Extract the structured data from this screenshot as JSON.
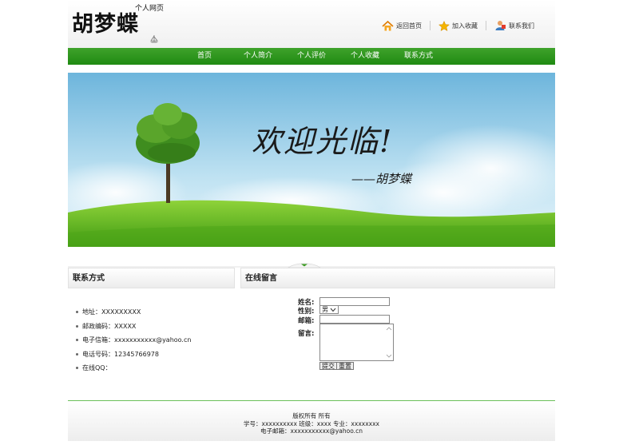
{
  "header": {
    "logo_text": "胡梦蝶",
    "logo_subtitle": "个人网页",
    "links": [
      {
        "label": "返回首页",
        "icon": "home-icon"
      },
      {
        "label": "加入收藏",
        "icon": "star-icon"
      },
      {
        "label": "联系我们",
        "icon": "contact-person-icon"
      }
    ]
  },
  "nav": {
    "items": [
      "首页",
      "个人简介",
      "个人评价",
      "个人收藏",
      "联系方式"
    ]
  },
  "banner": {
    "welcome_text": "欢迎光临!",
    "signature": "——胡梦蝶"
  },
  "contact": {
    "title": "联系方式",
    "items": [
      "地址：XXXXXXXXX",
      "邮政编码：XXXXX",
      "电子信箱：xxxxxxxxxxx@yahoo.cn",
      "电话号码：12345766978",
      "在线QQ："
    ]
  },
  "message": {
    "title": "在线留言",
    "name_label": "姓名:",
    "gender_label": "性别:",
    "gender_value": "男",
    "email_label": "邮箱:",
    "comment_label": "留言:",
    "submit_label": "提交",
    "reset_label": "重置"
  },
  "footer": {
    "line1": "版权所有 所有",
    "line2": "学号：xxxxxxxxxx 班级：xxxx 专业：xxxxxxxx",
    "line3": "电子邮箱：xxxxxxxxxxx@yahoo.cn"
  },
  "colors": {
    "nav_green": "#2a9a1a",
    "footer_line": "#6bbf5a"
  }
}
